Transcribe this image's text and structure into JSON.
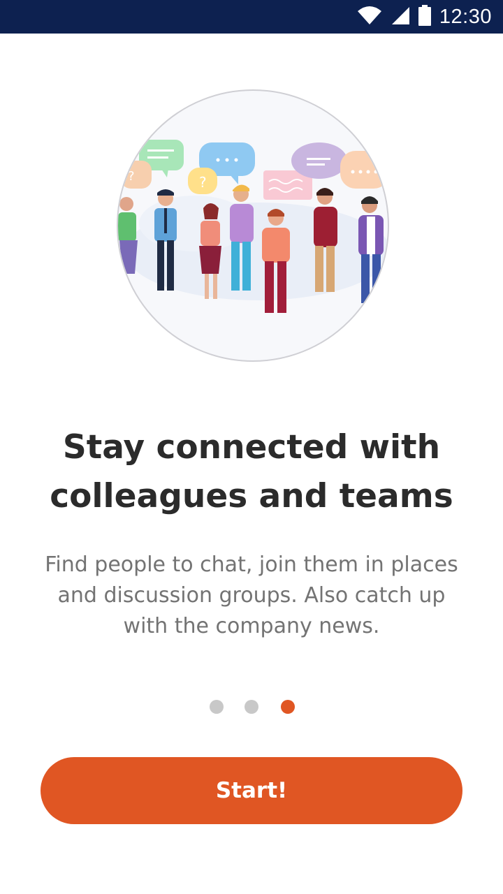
{
  "status_bar": {
    "time": "12:30",
    "icons": [
      "wifi-icon",
      "cellular-signal-icon",
      "battery-icon"
    ],
    "background": "#0d2150"
  },
  "illustration": {
    "description_icon": "people-chatting-illustration"
  },
  "onboarding": {
    "headline_line1": "Stay connected with",
    "headline_line2": "colleagues and teams",
    "body_line1": "Find people to chat, join them in places",
    "body_line2": "and discussion groups. Also catch up",
    "body_line3": "with the company news."
  },
  "pager": {
    "total_pages": 3,
    "active_page": 3
  },
  "start_button": {
    "label": "Start!"
  },
  "colors": {
    "accent": "#e05623",
    "inactive_dot": "#c8c8c8",
    "headline": "#2b2b2b",
    "body_text": "#737373"
  }
}
